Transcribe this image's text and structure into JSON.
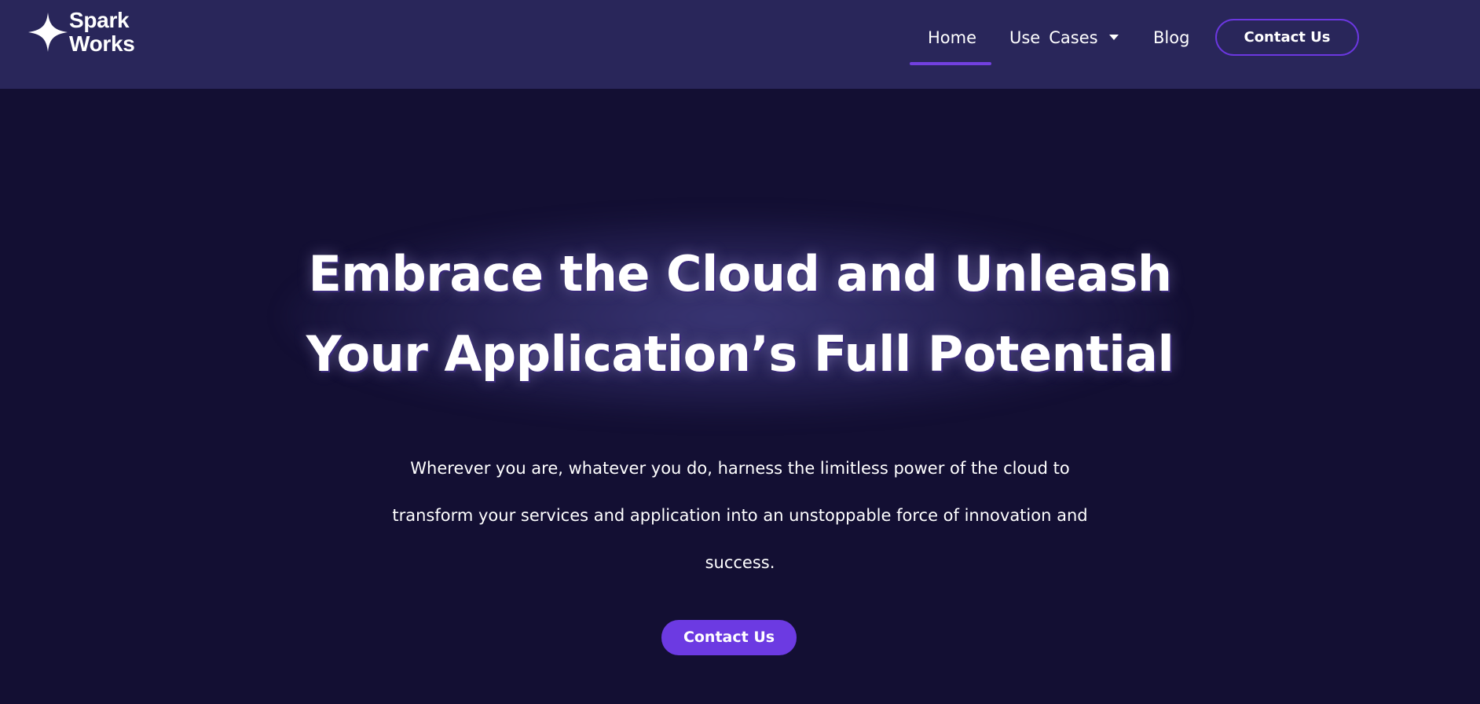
{
  "brand": {
    "name_line1": "Spark",
    "name_line2": "Works",
    "logo_icon": "four-point-star-icon"
  },
  "nav": {
    "items": [
      {
        "label": "Home",
        "active": true
      },
      {
        "label_part1": "Use",
        "label_part2": "Cases",
        "has_dropdown": true,
        "dropdown_icon": "caret-down-icon"
      },
      {
        "label": "Blog"
      }
    ],
    "cta_label": "Contact Us"
  },
  "hero": {
    "title_line1": "Embrace the Cloud and Unleash",
    "title_line2": "Your Application’s Full Potential",
    "subtitle_line1": "Wherever you are, whatever you do, harness the limitless power of the cloud to",
    "subtitle_line2": "transform your services and application into an unstoppable force of innovation and",
    "subtitle_line3": "success.",
    "cta_label": "Contact Us"
  },
  "colors": {
    "header_bg": "#29265a",
    "page_bg": "#130f33",
    "accent": "#6c3ae2",
    "text": "#ffffff"
  }
}
